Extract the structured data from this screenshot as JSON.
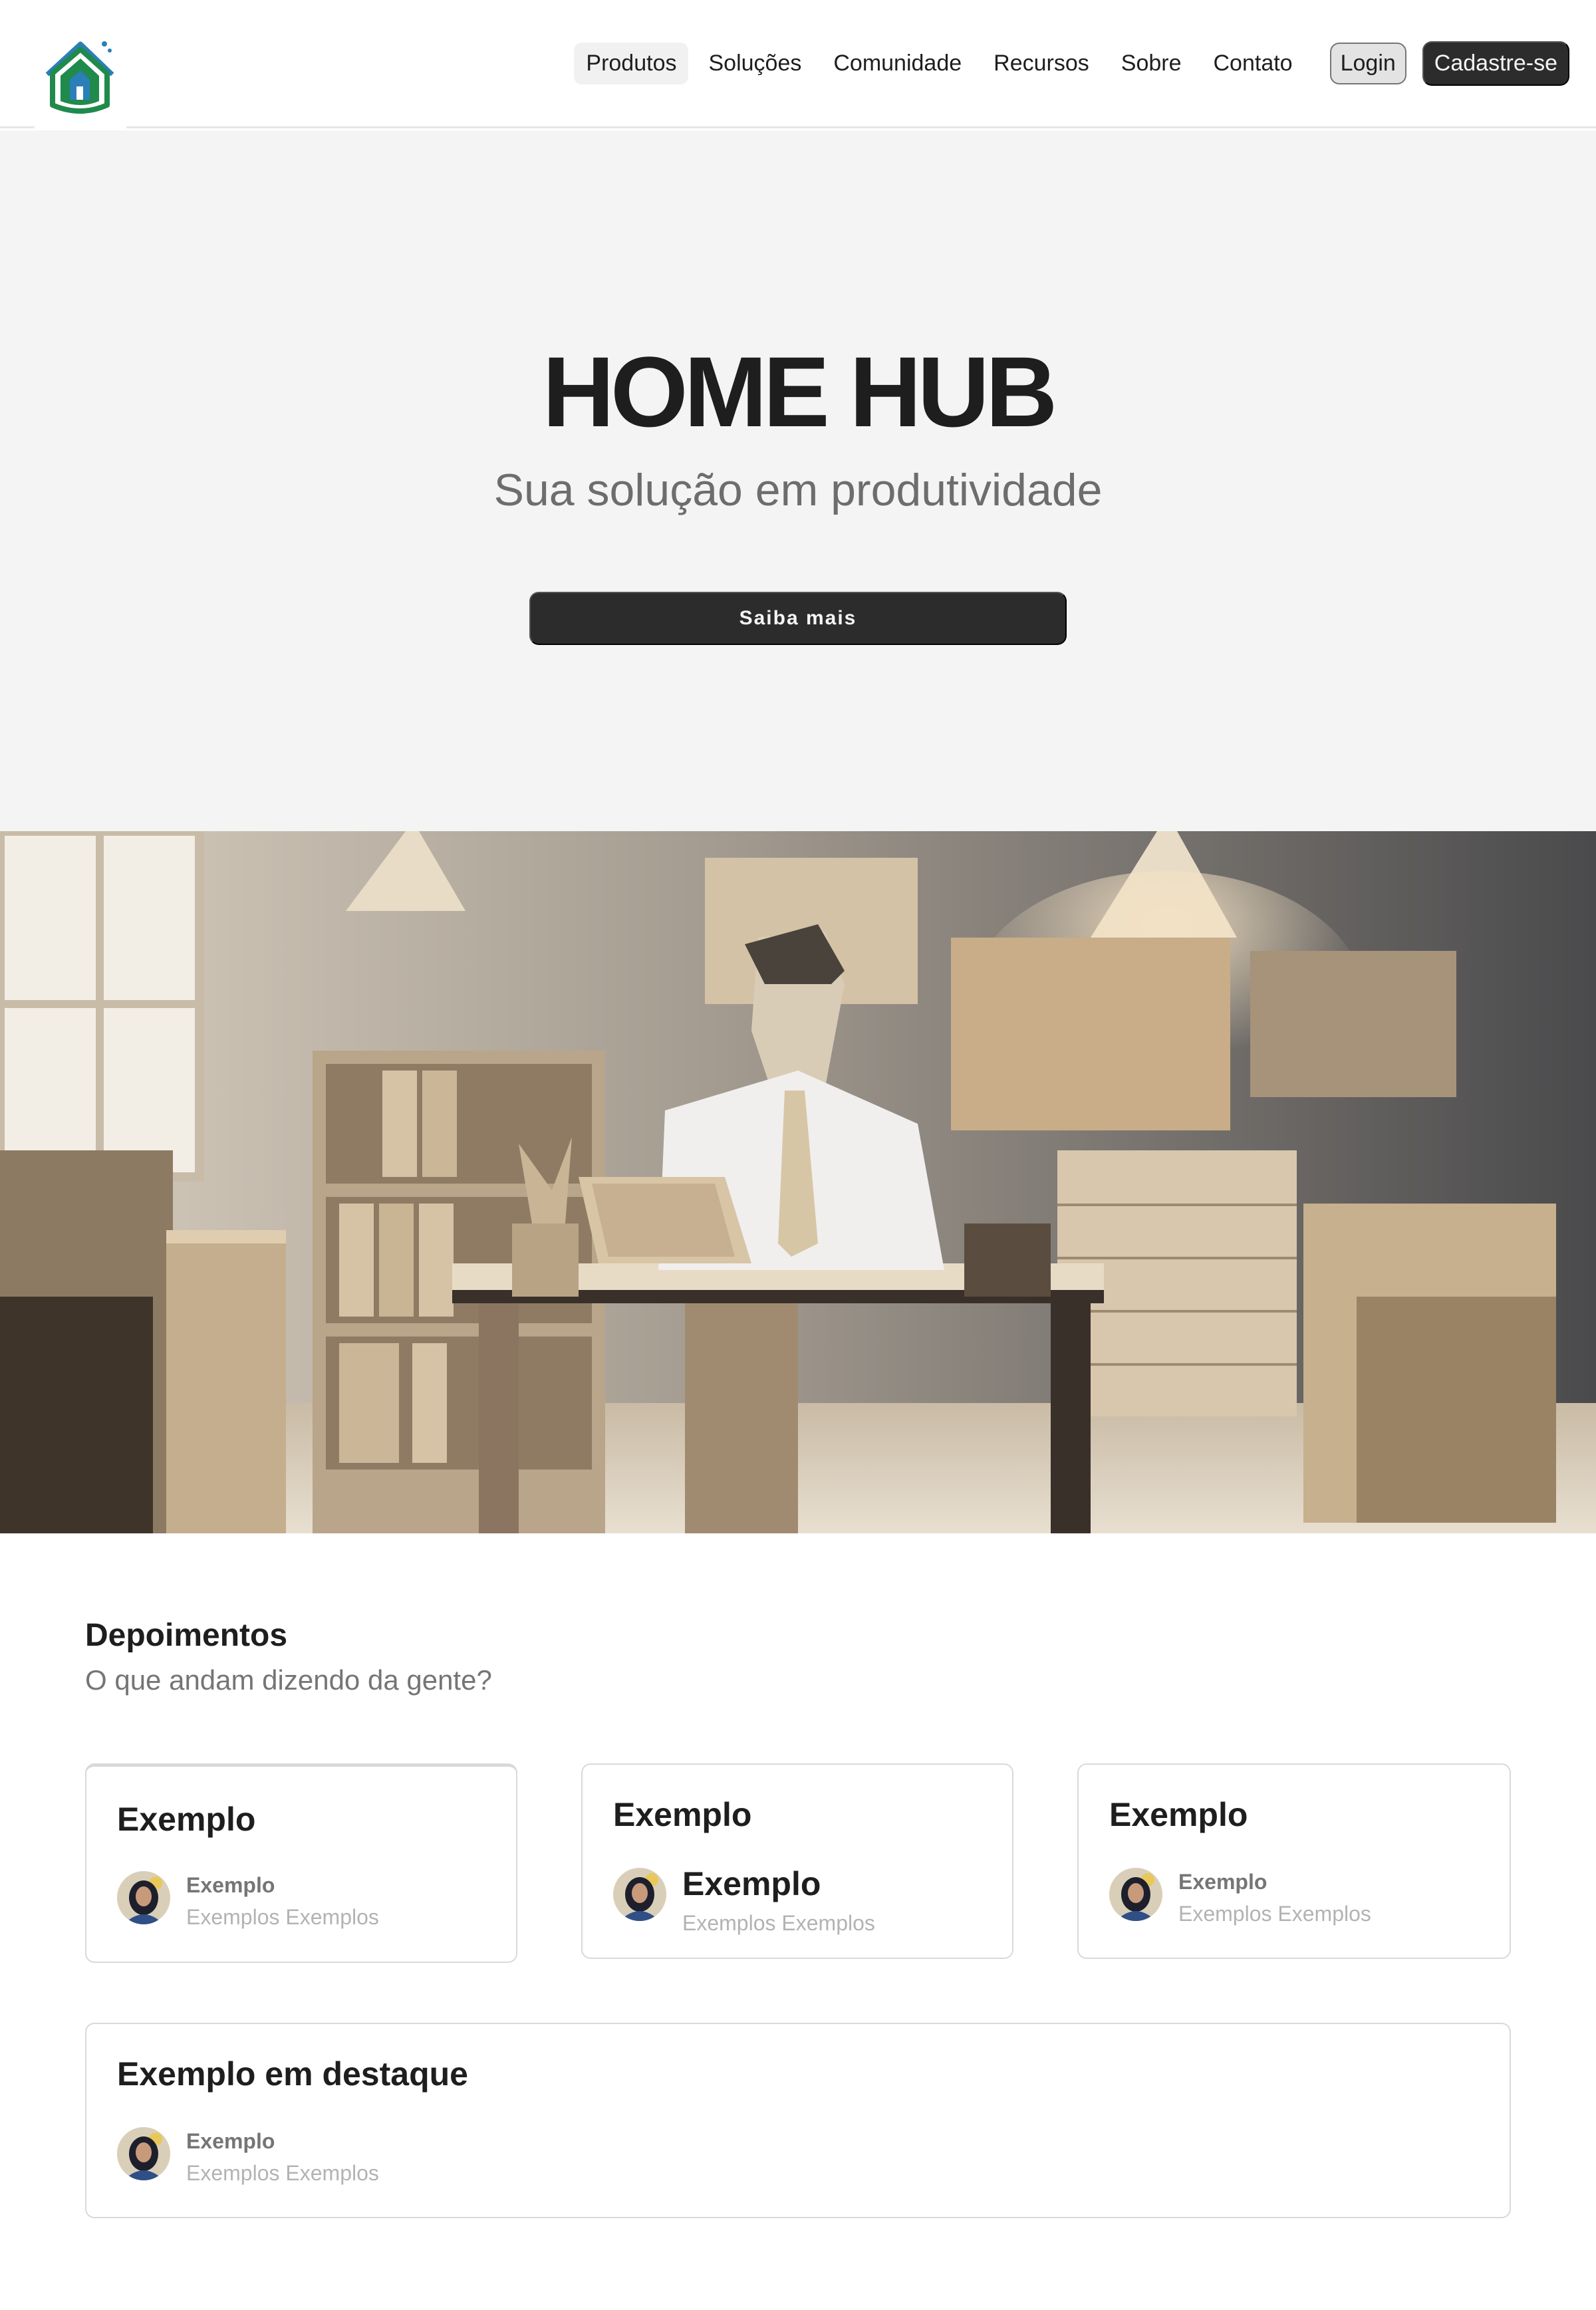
{
  "header": {
    "logo_icon": "house-logo-icon",
    "nav": [
      {
        "label": "Produtos",
        "active": true
      },
      {
        "label": "Soluções"
      },
      {
        "label": "Comunidade"
      },
      {
        "label": "Recursos"
      },
      {
        "label": "Sobre"
      },
      {
        "label": "Contato"
      }
    ],
    "login_label": "Login",
    "signup_label": "Cadastre-se"
  },
  "hero": {
    "title": "HOME HUB",
    "subtitle": "Sua solução em produtividade",
    "button_label": "Saiba mais",
    "image": "papercraft-office-illustration"
  },
  "testimonials": {
    "title": "Depoimentos",
    "subtitle": "O que andam dizendo da gente?",
    "cards": [
      {
        "quote": "Exemplo",
        "author": "Exemplo",
        "role": "Exemplos Exemplos"
      },
      {
        "quote": "Exemplo",
        "author": "Exemplo",
        "role": "Exemplos Exemplos"
      },
      {
        "quote": "Exemplo",
        "author": "Exemplo",
        "role": "Exemplos Exemplos"
      }
    ],
    "featured": {
      "quote": "Exemplo em destaque",
      "author": "Exemplo",
      "role": "Exemplos Exemplos"
    }
  },
  "colors": {
    "dark_button": "#2c2c2c",
    "hero_bg": "#f4f4f4",
    "text": "#1e1e1e",
    "muted": "#757575",
    "logo_green": "#1f8a4c",
    "logo_blue": "#2a7fb8"
  }
}
